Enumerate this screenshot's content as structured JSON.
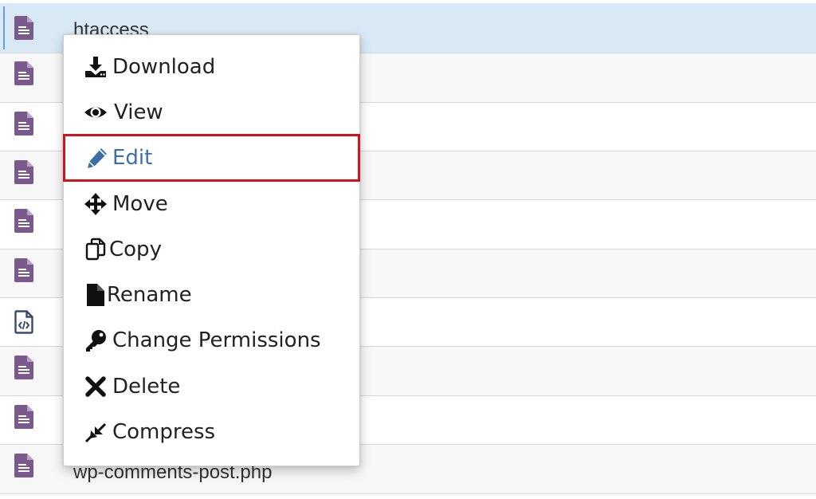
{
  "colors": {
    "file_icon_purple": "#7a5a8d",
    "selected_row": "#d9e8f5",
    "highlight_border": "#d2121c",
    "edit_label": "#3d6fa6"
  },
  "files": [
    {
      "name": "htaccess",
      "icon": "file-text-icon",
      "selected": true
    },
    {
      "name": "",
      "icon": "file-text-icon"
    },
    {
      "name": "",
      "icon": "file-text-icon"
    },
    {
      "name": "",
      "icon": "file-text-icon"
    },
    {
      "name": "",
      "icon": "file-text-icon"
    },
    {
      "name": "",
      "icon": "file-text-icon"
    },
    {
      "name": "",
      "icon": "file-code-icon"
    },
    {
      "name": "",
      "icon": "file-text-icon"
    },
    {
      "name": "",
      "icon": "file-text-icon"
    },
    {
      "name": "wp-comments-post.php",
      "icon": "file-text-icon"
    }
  ],
  "context_menu": {
    "items": [
      {
        "label": "Download",
        "icon": "download-icon"
      },
      {
        "label": "View",
        "icon": "eye-icon"
      },
      {
        "label": "Edit",
        "icon": "pencil-icon",
        "highlighted": true
      },
      {
        "label": "Move",
        "icon": "move-arrows-icon"
      },
      {
        "label": "Copy",
        "icon": "copy-icon"
      },
      {
        "label": "Rename",
        "icon": "file-icon"
      },
      {
        "label": "Change Permissions",
        "icon": "key-icon"
      },
      {
        "label": "Delete",
        "icon": "close-icon"
      },
      {
        "label": "Compress",
        "icon": "compress-icon"
      }
    ]
  }
}
